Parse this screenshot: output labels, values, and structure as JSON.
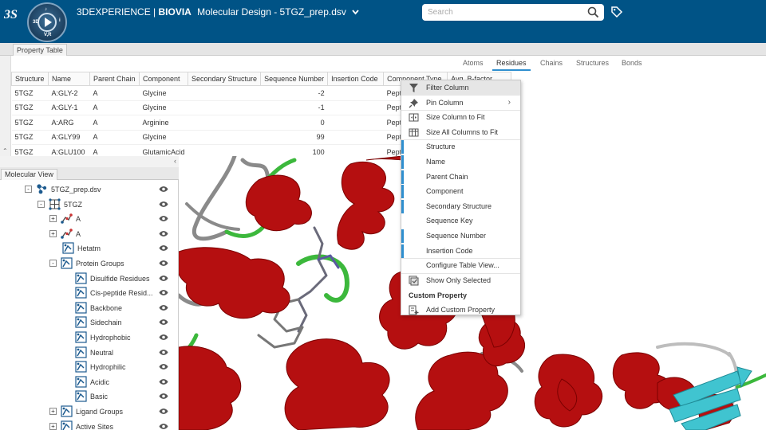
{
  "app": {
    "brand_prefix": "3DEXPERIENCE | ",
    "brand_bold": "BIOVIA",
    "title": "Molecular Design - 5TGZ_prep.dsv",
    "compass_label": "3D",
    "compass_sub": "V,R",
    "compass_i": "i",
    "compass_gt": "♪"
  },
  "search": {
    "placeholder": "Search"
  },
  "property_table": {
    "tab_label": "Property Table",
    "subtabs": [
      "Atoms",
      "Residues",
      "Chains",
      "Structures",
      "Bonds"
    ],
    "active_subtab": "Residues",
    "columns": [
      "Structure",
      "Name",
      "Parent Chain",
      "Component",
      "Secondary Structure",
      "Sequence Number",
      "Insertion Code",
      "Component Type",
      "Avg. B-factor"
    ],
    "rows": [
      [
        "5TGZ",
        "A:GLY-2",
        "A",
        "Glycine",
        "",
        "-2",
        "",
        "Pept",
        ""
      ],
      [
        "5TGZ",
        "A:GLY-1",
        "A",
        "Glycine",
        "",
        "-1",
        "",
        "Pept",
        ""
      ],
      [
        "5TGZ",
        "A:ARG",
        "A",
        "Arginine",
        "",
        "0",
        "",
        "Pept",
        ""
      ],
      [
        "5TGZ",
        "A:GLY99",
        "A",
        "Glycine",
        "",
        "99",
        "",
        "Pept",
        ""
      ],
      [
        "5TGZ",
        "A:GLU100",
        "A",
        "GlutamicAcid",
        "",
        "100",
        "",
        "Pept",
        ""
      ]
    ]
  },
  "molecular_view": {
    "tab_label": "Molecular View",
    "tree": [
      {
        "label": "5TGZ_prep.dsv",
        "expander": "-",
        "icon": "dataset-icon",
        "level": 0
      },
      {
        "label": "5TGZ",
        "expander": "-",
        "icon": "structure-icon",
        "level": 1
      },
      {
        "label": "A",
        "expander": "+",
        "icon": "chain-icon",
        "level": 2
      },
      {
        "label": "A",
        "expander": "+",
        "icon": "chain-icon",
        "level": 2
      },
      {
        "label": "Hetatm",
        "expander": "",
        "icon": "group-icon",
        "level": 2
      },
      {
        "label": "Protein Groups",
        "expander": "-",
        "icon": "group-icon",
        "level": 2
      },
      {
        "label": "Disulfide Residues",
        "expander": "",
        "icon": "group-icon",
        "level": 3
      },
      {
        "label": "Cis-peptide Resid...",
        "expander": "",
        "icon": "group-icon",
        "level": 3
      },
      {
        "label": "Backbone",
        "expander": "",
        "icon": "group-icon",
        "level": 3
      },
      {
        "label": "Sidechain",
        "expander": "",
        "icon": "group-icon",
        "level": 3
      },
      {
        "label": "Hydrophobic",
        "expander": "",
        "icon": "group-icon",
        "level": 3
      },
      {
        "label": "Neutral",
        "expander": "",
        "icon": "group-icon",
        "level": 3
      },
      {
        "label": "Hydrophilic",
        "expander": "",
        "icon": "group-icon",
        "level": 3
      },
      {
        "label": "Acidic",
        "expander": "",
        "icon": "group-icon",
        "level": 3
      },
      {
        "label": "Basic",
        "expander": "",
        "icon": "group-icon",
        "level": 3
      },
      {
        "label": "Ligand Groups",
        "expander": "+",
        "icon": "group-icon",
        "level": 2
      },
      {
        "label": "Active Sites",
        "expander": "+",
        "icon": "group-icon",
        "level": 2
      }
    ]
  },
  "context_menu": {
    "items": [
      {
        "label": "Filter Column",
        "icon": "filter-icon",
        "type": "action",
        "highlight": true
      },
      {
        "label": "Pin Column",
        "icon": "pin-icon",
        "type": "submenu"
      },
      {
        "label": "Size Column to Fit",
        "icon": "size-column-icon",
        "type": "action"
      },
      {
        "label": "Size All Columns to Fit",
        "icon": "size-all-columns-icon",
        "type": "action"
      },
      {
        "label": "Structure",
        "type": "column",
        "checked": true
      },
      {
        "label": "Name",
        "type": "column",
        "checked": true
      },
      {
        "label": "Parent Chain",
        "type": "column",
        "checked": true
      },
      {
        "label": "Component",
        "type": "column",
        "checked": true
      },
      {
        "label": "Secondary Structure",
        "type": "column",
        "checked": true
      },
      {
        "label": "Sequence Key",
        "type": "column",
        "checked": false
      },
      {
        "label": "Sequence Number",
        "type": "column",
        "checked": true
      },
      {
        "label": "Insertion Code",
        "type": "column",
        "checked": true
      },
      {
        "label": "Configure Table View...",
        "type": "action"
      },
      {
        "label": "Show Only Selected",
        "icon": "show-selected-icon",
        "type": "action"
      }
    ],
    "section_title": "Custom Property",
    "add_custom": "Add Custom Property",
    "submenu_arrow": "›"
  },
  "colors": {
    "header_bg": "#005386",
    "accent": "#2f8fcf",
    "helix": "#c00000",
    "loop_green": "#3cb83c",
    "sheet_cyan": "#40c4d0"
  }
}
